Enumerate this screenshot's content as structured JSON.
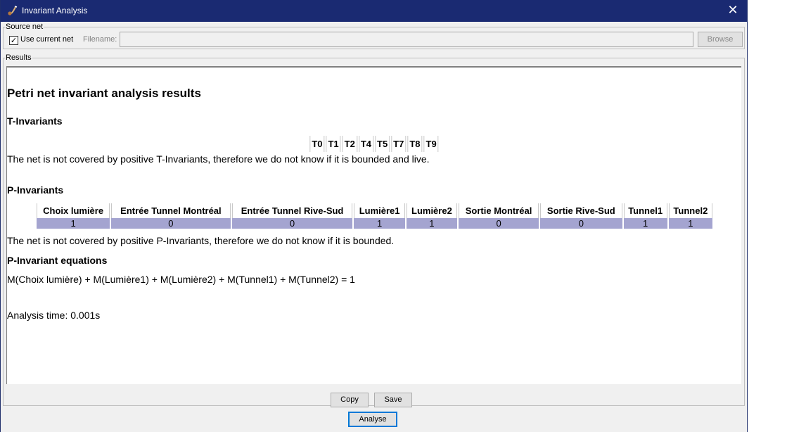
{
  "window": {
    "title": "Invariant Analysis",
    "close_glyph": "✕",
    "app_icon": "pipe-icon"
  },
  "source": {
    "legend": "Source net",
    "use_current_checked": true,
    "use_current_label": "Use current net",
    "filename_label": "Filename:",
    "filename_value": "",
    "browse_label": "Browse"
  },
  "results": {
    "legend": "Results",
    "heading": "Petri net invariant analysis results",
    "t_heading": "T-Invariants",
    "t_columns": [
      "T0",
      "T1",
      "T2",
      "T4",
      "T5",
      "T7",
      "T8",
      "T9"
    ],
    "t_message": "The net is not covered by positive T-Invariants, therefore we do not know if it is bounded and live.",
    "p_heading": "P-Invariants",
    "p_columns": [
      "Choix lumière",
      "Entrée Tunnel Montréal",
      "Entrée Tunnel Rive-Sud",
      "Lumière1",
      "Lumière2",
      "Sortie Montréal",
      "Sortie Rive-Sud",
      "Tunnel1",
      "Tunnel2"
    ],
    "p_values": [
      "1",
      "0",
      "0",
      "1",
      "1",
      "0",
      "0",
      "1",
      "1"
    ],
    "p_row_color": "#a4a4d0",
    "p_message": "The net is not covered by positive P-Invariants, therefore we do not know if it is bounded.",
    "eq_heading": "P-Invariant equations",
    "equation": "M(Choix lumière) + M(Lumière1) + M(Lumière2) + M(Tunnel1) + M(Tunnel2) = 1",
    "time": "Analysis time: 0.001s"
  },
  "buttons": {
    "copy": "Copy",
    "save": "Save",
    "analyse": "Analyse"
  },
  "colors": {
    "titlebar": "#1a2a72"
  }
}
